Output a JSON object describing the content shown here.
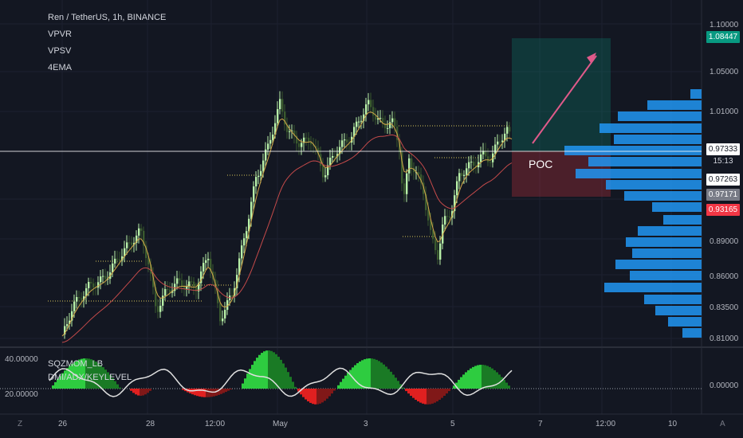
{
  "legend": {
    "title": "Ren / TetherUS, 1h, BINANCE",
    "indicators": [
      "VPVR",
      "VPSV",
      "4EMA"
    ]
  },
  "oscillator": {
    "labels": [
      "SQZMOM_LB",
      "DMI/ADX/KEYLEVEL"
    ],
    "scale": [
      "40.00000",
      "20.00000"
    ],
    "right_value": "0.00000"
  },
  "price_axis": {
    "ticks": [
      "1.10000",
      "1.05000",
      "1.01000",
      "0.89000",
      "0.86000",
      "0.83500",
      "0.81000"
    ],
    "tags": {
      "target": "1.08447",
      "current": "0.97333",
      "countdown": "15:13",
      "mid": "0.97263",
      "entry": "0.97171",
      "stop": "0.93165"
    }
  },
  "time_axis": {
    "labels": [
      "26",
      "28",
      "12:00",
      "May",
      "3",
      "5",
      "7",
      "12:00",
      "10"
    ]
  },
  "annotation": {
    "poc_label": "POC"
  },
  "corner": {
    "left": "Z",
    "right": "A"
  },
  "colors": {
    "background": "#131722",
    "up_candle": "#b8f0a8",
    "down_candle": "#3a5a2e",
    "ema_fast": "#d4a84a",
    "ema_slow": "#c44a4a",
    "volume_profile": "#2196f3",
    "target_zone": "rgba(8,153,129,0.25)",
    "stop_zone": "rgba(242,54,69,0.25)",
    "current_tag": "#ffffff",
    "target_tag": "#089981",
    "stop_tag": "#f23645",
    "entry_tag": "#787b86",
    "arrow": "#e05a8a"
  }
}
